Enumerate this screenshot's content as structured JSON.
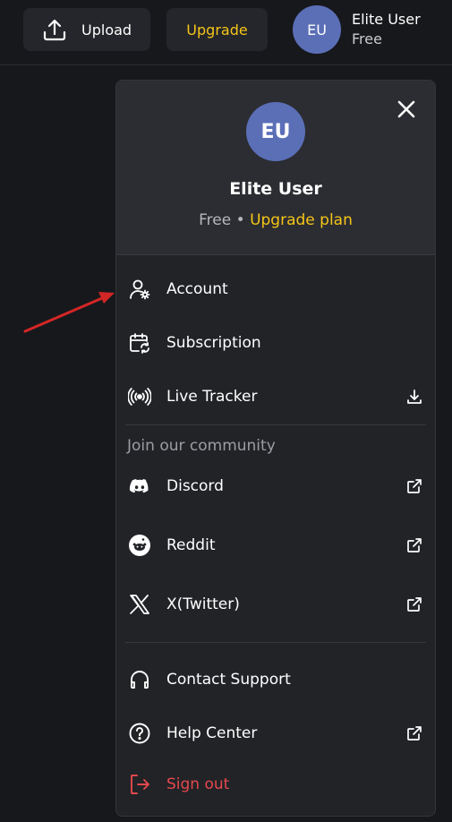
{
  "topbar": {
    "upload_label": "Upload",
    "upgrade_label": "Upgrade",
    "avatar_initials": "EU",
    "user_name": "Elite User",
    "user_plan": "Free"
  },
  "menu": {
    "avatar_initials": "EU",
    "user_name": "Elite User",
    "plan": "Free",
    "plan_separator": "•",
    "upgrade_link": "Upgrade plan",
    "items": {
      "account": "Account",
      "subscription": "Subscription",
      "live_tracker": "Live Tracker"
    },
    "community_label": "Join our community",
    "community": {
      "discord": "Discord",
      "reddit": "Reddit",
      "twitter": "X(Twitter)"
    },
    "support": {
      "contact": "Contact Support",
      "help": "Help Center",
      "signout": "Sign out"
    }
  },
  "colors": {
    "background": "#17181c",
    "accent_yellow": "#f5c518",
    "avatar_blue": "#5b6fb7",
    "signout_red": "#e5484d",
    "annotation_arrow": "#d32626"
  }
}
